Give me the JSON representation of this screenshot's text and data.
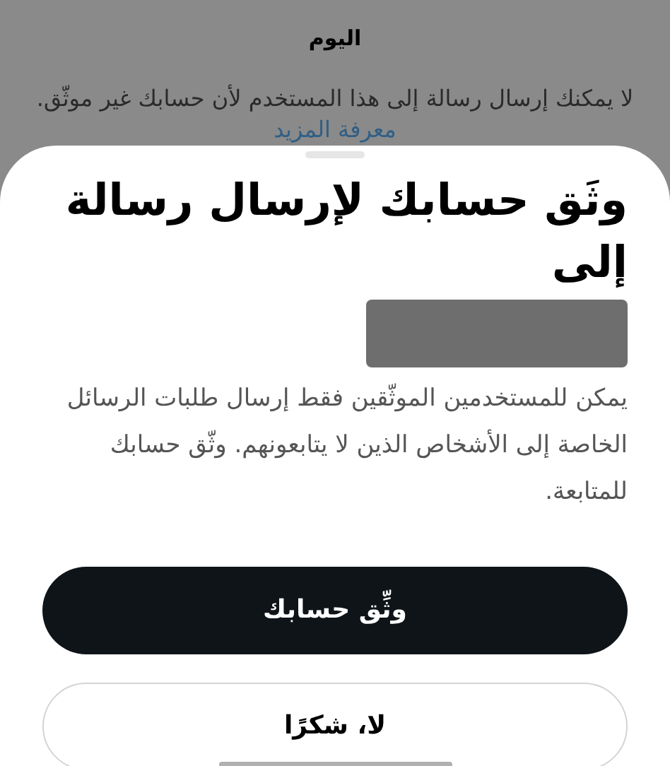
{
  "background": {
    "date_label": "اليوم",
    "notice": "لا يمكنك إرسال رسالة إلى هذا المستخدم لأن حسابك غير موثّق.",
    "link": "معرفة المزيد"
  },
  "sheet": {
    "title": "وثَق حسابك لإرسال رسالة إلى",
    "recipient_redacted": true,
    "body": "يمكن للمستخدمين الموثّقين فقط إرسال طلبات الرسائل الخاصة إلى الأشخاص الذين لا يتابعونهم. وثّق حسابك للمتابعة.",
    "buttons": [
      {
        "kind": "primary",
        "label": "وثِّق حسابك"
      },
      {
        "kind": "secondary",
        "label": "لا، شكرًا"
      }
    ]
  }
}
